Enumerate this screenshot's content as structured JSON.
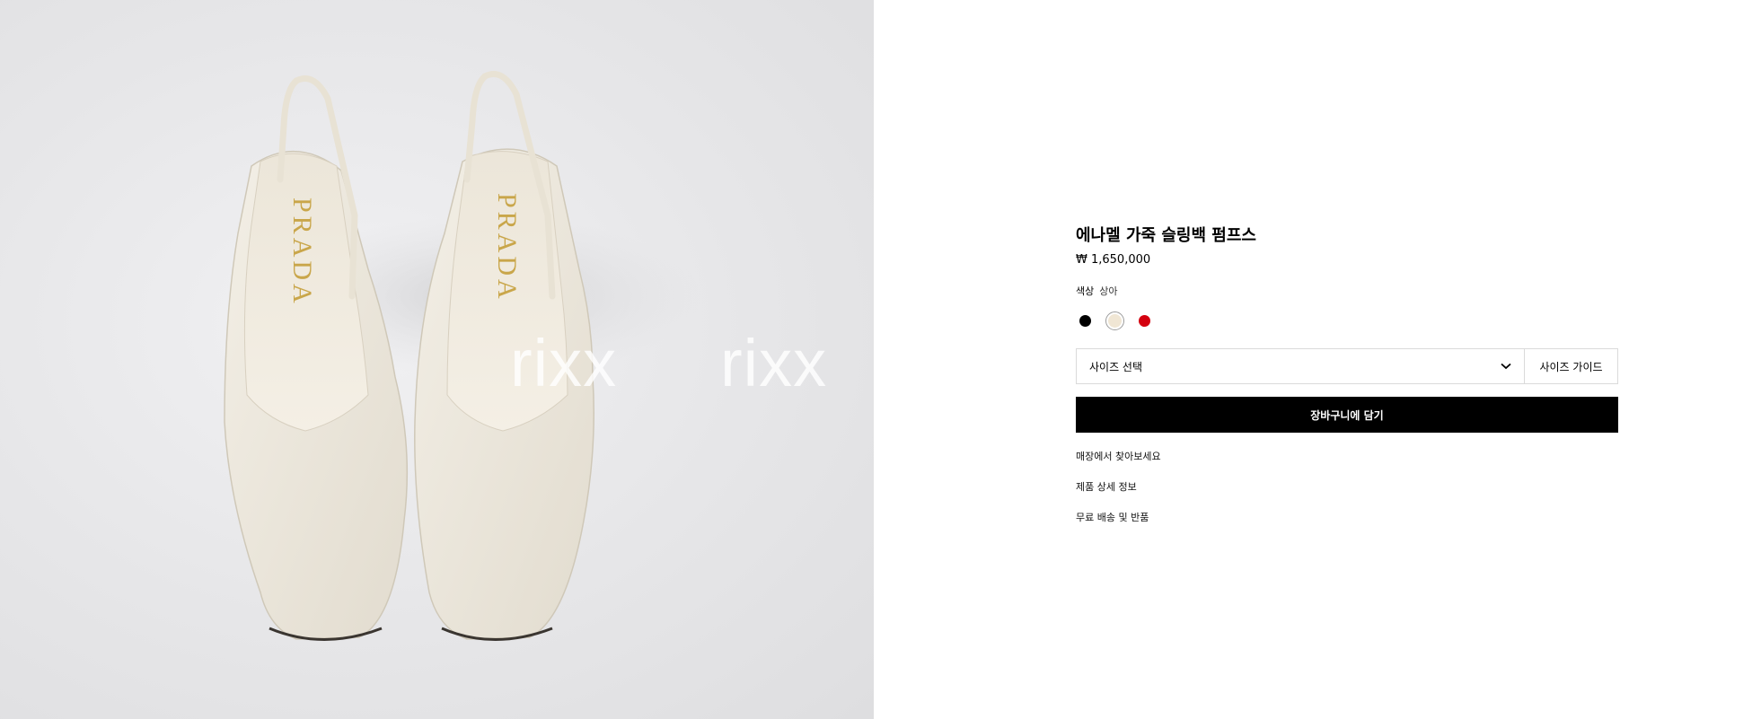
{
  "watermark": {
    "text_1": "rixx",
    "text_2": "rixx"
  },
  "product": {
    "title": "에나멜 가죽 슬링백 펌프스",
    "price": "₩ 1,650,000",
    "brand_print": "PRADA"
  },
  "color": {
    "label": "색상",
    "selected": "상아",
    "swatches": [
      {
        "name": "black",
        "hex": "#000000"
      },
      {
        "name": "ivory",
        "hex": "#f0e6d4"
      },
      {
        "name": "red",
        "hex": "#d4000f"
      }
    ]
  },
  "size": {
    "placeholder": "사이즈 선택",
    "guide_label": "사이즈 가이드"
  },
  "cart": {
    "label": "장바구니에 담기"
  },
  "links": [
    "매장에서 찾아보세요",
    "제품 상세 정보",
    "무료 배송 및 반품"
  ]
}
